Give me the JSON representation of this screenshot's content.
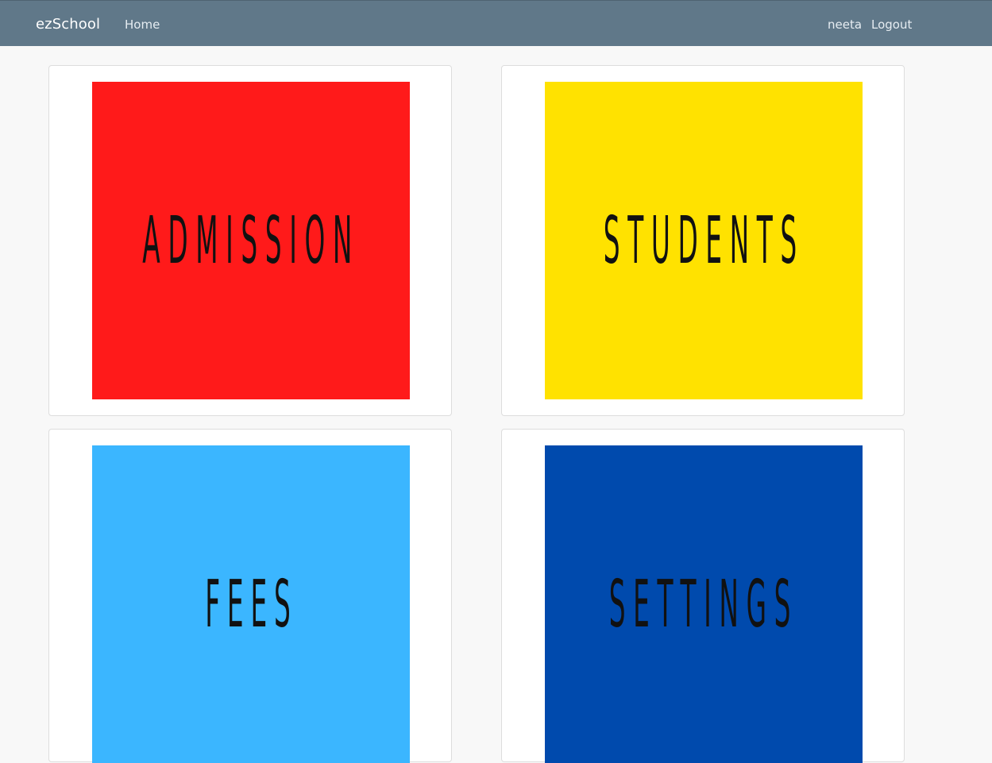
{
  "navbar": {
    "brand": "ezSchool",
    "home": "Home",
    "user": "neeta",
    "logout": "Logout"
  },
  "tiles": [
    {
      "label": "ADMISSION",
      "color": "#ff1a1a"
    },
    {
      "label": "STUDENTS",
      "color": "#ffe200"
    },
    {
      "label": "FEES",
      "color": "#3bb6ff"
    },
    {
      "label": "SETTINGS",
      "color": "#004aad"
    }
  ],
  "colors": {
    "navbar": "#607889",
    "page_background": "#f8f8f8",
    "card_background": "#ffffff",
    "tile_text": "#111111"
  }
}
